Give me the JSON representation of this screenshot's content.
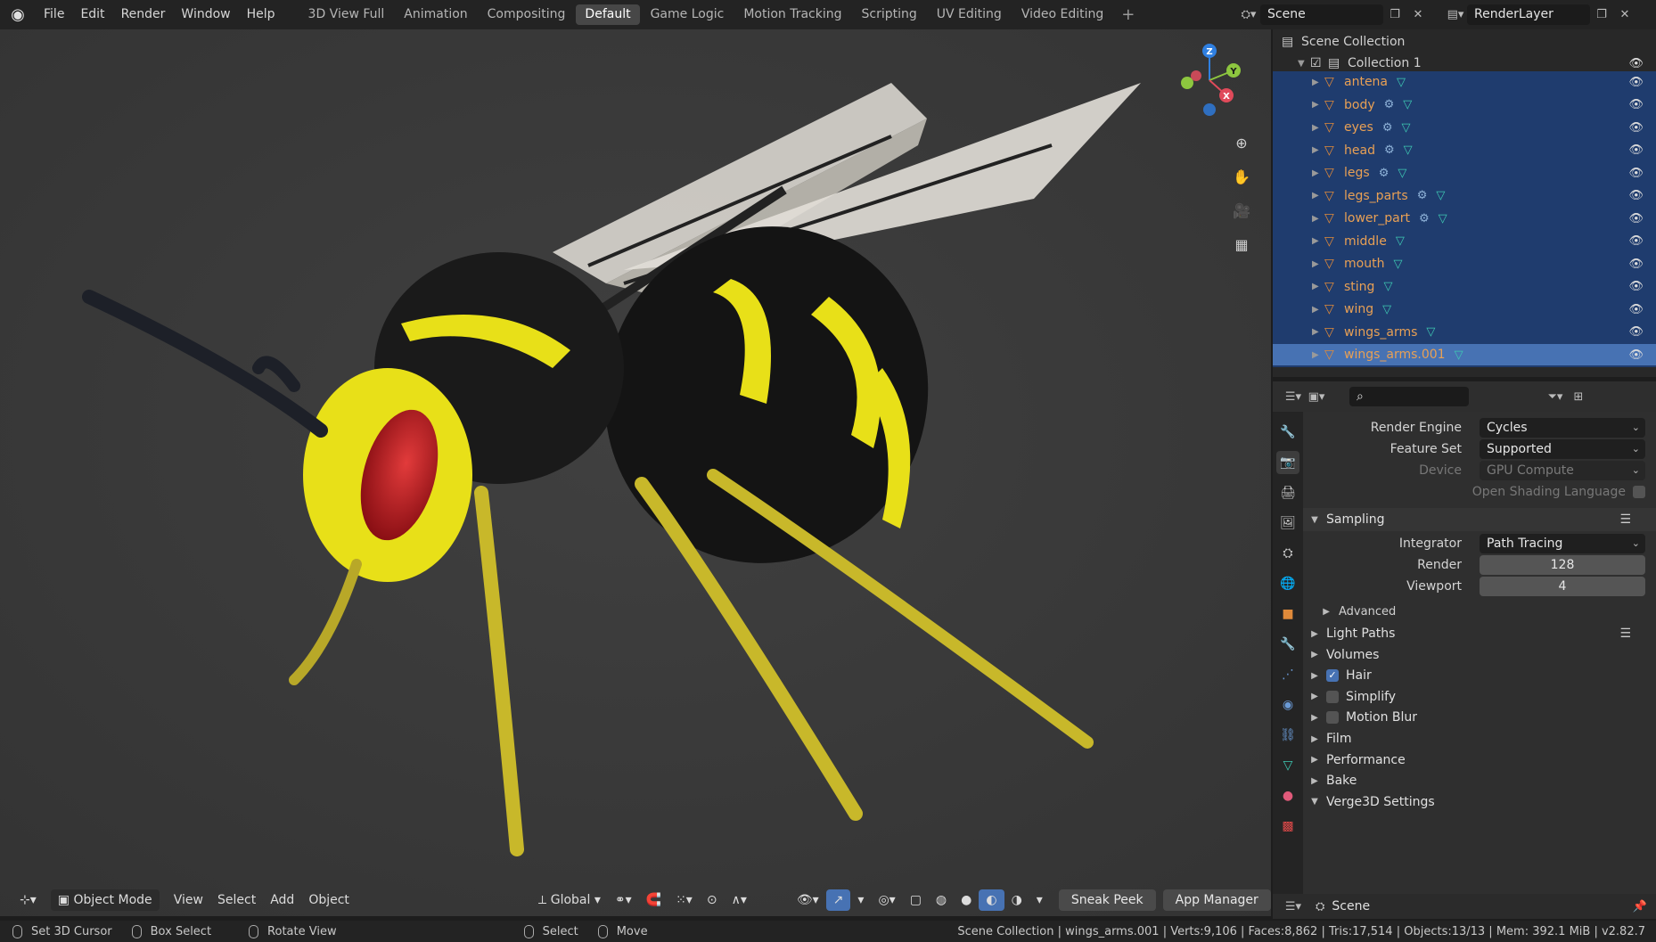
{
  "menu": [
    "File",
    "Edit",
    "Render",
    "Window",
    "Help"
  ],
  "workspaces": [
    "3D View Full",
    "Animation",
    "Compositing",
    "Default",
    "Game Logic",
    "Motion Tracking",
    "Scripting",
    "UV Editing",
    "Video Editing"
  ],
  "active_workspace": "Default",
  "scene_name": "Scene",
  "view_layer": "RenderLayer",
  "outliner": {
    "root": "Scene Collection",
    "collection": "Collection 1",
    "objects": [
      "antena",
      "body",
      "eyes",
      "head",
      "legs",
      "legs_parts",
      "lower_part",
      "middle",
      "mouth",
      "sting",
      "wing",
      "wings_arms",
      "wings_arms.001"
    ],
    "with_modifier": [
      "body",
      "eyes",
      "head",
      "legs",
      "legs_parts",
      "lower_part"
    ],
    "active_object": "wings_arms.001"
  },
  "viewport": {
    "mode": "Object Mode",
    "menus": [
      "View",
      "Select",
      "Add",
      "Object"
    ],
    "orientation": "Global",
    "sneak_peek": "Sneak Peek",
    "app_manager": "App Manager",
    "gizmo_axes": [
      "X",
      "Y",
      "Z"
    ]
  },
  "properties": {
    "render_engine_label": "Render Engine",
    "render_engine": "Cycles",
    "feature_set_label": "Feature Set",
    "feature_set": "Supported",
    "device_label": "Device",
    "device": "GPU Compute",
    "osl_label": "Open Shading Language",
    "sampling": "Sampling",
    "integrator_label": "Integrator",
    "integrator": "Path Tracing",
    "render_label": "Render",
    "render_samples": "128",
    "viewport_label": "Viewport",
    "viewport_samples": "4",
    "advanced": "Advanced",
    "panels": [
      "Light Paths",
      "Volumes",
      "Hair",
      "Simplify",
      "Motion Blur",
      "Film",
      "Performance",
      "Bake",
      "Verge3D Settings"
    ],
    "checked_panels": [
      "Hair"
    ],
    "bottom_scene": "Scene"
  },
  "statusbar": {
    "set_cursor": "Set 3D Cursor",
    "box_select": "Box Select",
    "rotate_view": "Rotate View",
    "select": "Select",
    "move": "Move",
    "info": "Scene Collection | wings_arms.001 | Verts:9,106 | Faces:8,862 | Tris:17,514 | Objects:13/13 | Mem: 392.1 MiB | v2.82.7"
  },
  "colors": {
    "selection_bg": "#1f3c6e",
    "active_bg": "#4772b3",
    "object_name": "#e8a055",
    "mesh_data": "#3ec9b3",
    "viewport_bg": "#3a3a3a"
  }
}
